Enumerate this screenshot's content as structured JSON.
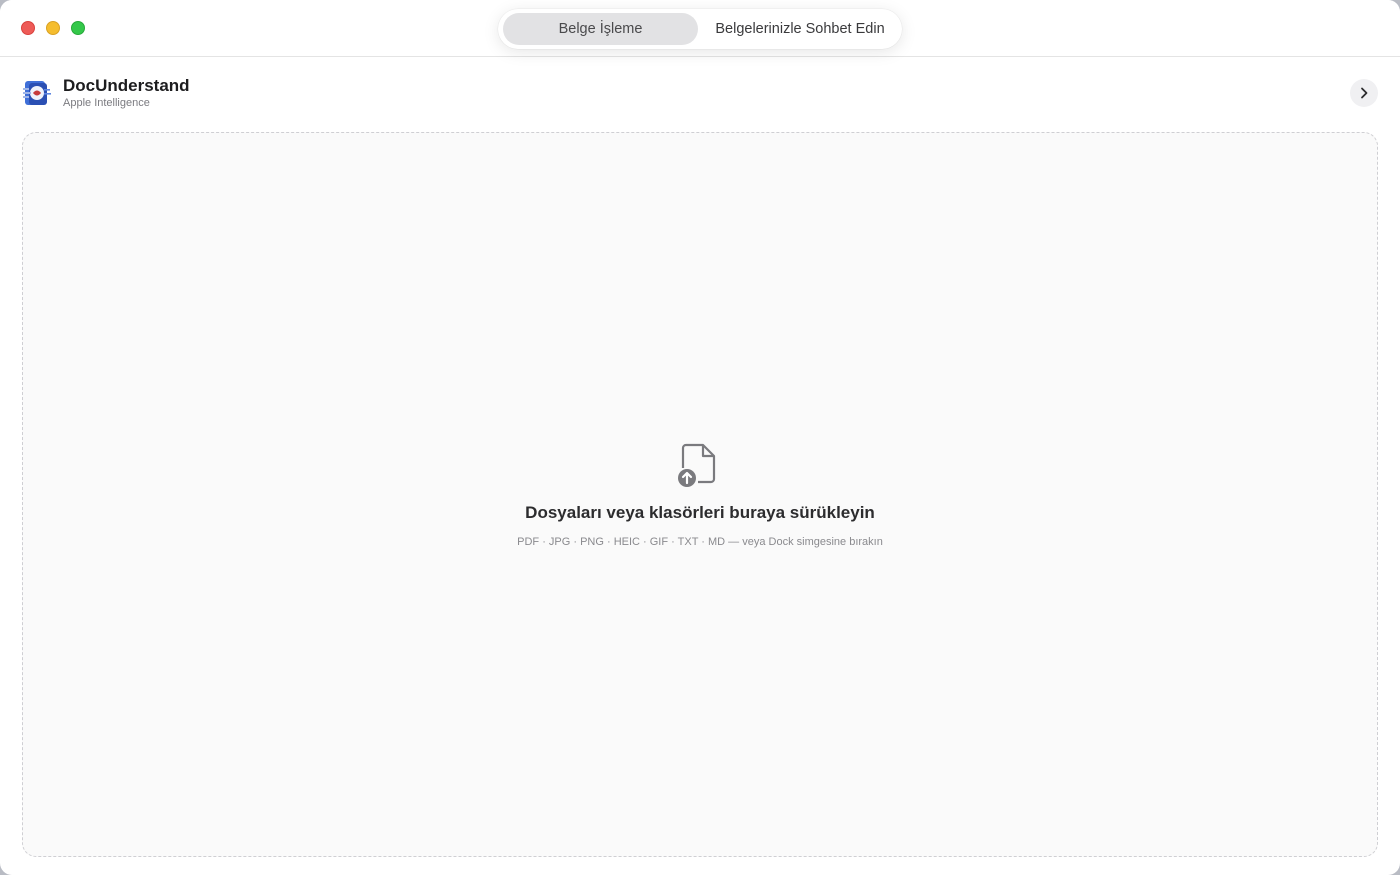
{
  "tabs": {
    "processing": "Belge İşleme",
    "chat": "Belgelerinizle Sohbet Edin",
    "selected": "Belge İşleme"
  },
  "app": {
    "name": "DocUnderstand",
    "subtitle": "Apple Intelligence",
    "logo_icon": "doc-understand-logo"
  },
  "dropzone": {
    "title": "Dosyaları veya klasörleri buraya sürükleyin",
    "subtitle": "PDF · JPG · PNG · HEIC · GIF · TXT · MD — veya Dock simgesine bırakın",
    "icon": "document-upload-icon"
  },
  "colors": {
    "close": "#ee5b57",
    "minimize": "#f5bd2e",
    "zoom": "#34c84a",
    "selected_tab": "#e2e2e4"
  }
}
